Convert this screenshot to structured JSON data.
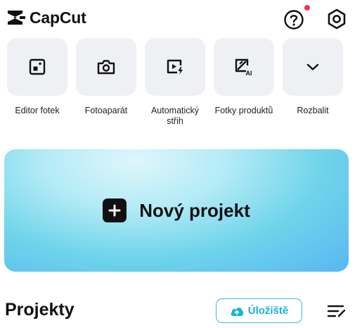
{
  "app": {
    "name": "CapCut"
  },
  "header": {
    "help_icon": "help-circle-icon",
    "settings_icon": "settings-hexagon-icon",
    "notification_dot_color": "#f2334d"
  },
  "tools": [
    {
      "label": "Editor fotek",
      "icon": "photo-editor-icon"
    },
    {
      "label": "Fotoaparát",
      "icon": "camera-icon"
    },
    {
      "label": "Automatický střih",
      "icon": "auto-cut-icon"
    },
    {
      "label": "Fotky produktů",
      "icon": "ai-product-photo-icon"
    },
    {
      "label": "Rozbalit",
      "icon": "chevron-down-icon"
    }
  ],
  "new_project": {
    "label": "Nový projekt"
  },
  "projects": {
    "title": "Projekty",
    "storage_label": "Úložiště",
    "accent_color": "#19b3d4"
  }
}
